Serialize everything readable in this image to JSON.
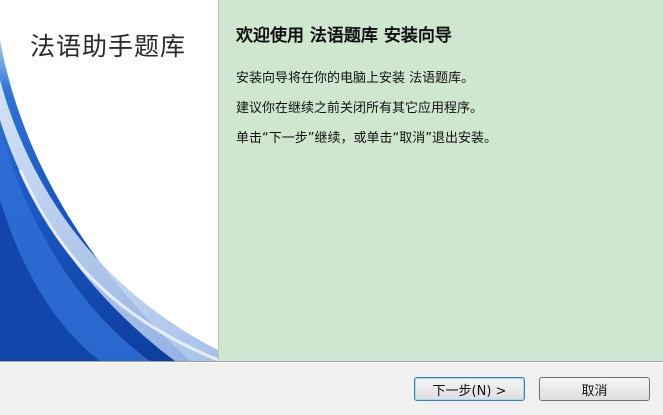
{
  "sidebar": {
    "title": "法语助手题库"
  },
  "main": {
    "heading": "欢迎使用 法语题库 安装向导",
    "lines": [
      "安装向导将在你的电脑上安装 法语题库。",
      "建议你在继续之前关闭所有其它应用程序。",
      "单击“下一步”继续，或单击“取消”退出安装。"
    ]
  },
  "buttons": {
    "next_label": "下一步(N) >",
    "cancel_label": "取消"
  },
  "colors": {
    "main_background": "#cfe7cf",
    "sidebar_accent": "#1f5fc7",
    "footer_background": "#f0f0f0"
  }
}
